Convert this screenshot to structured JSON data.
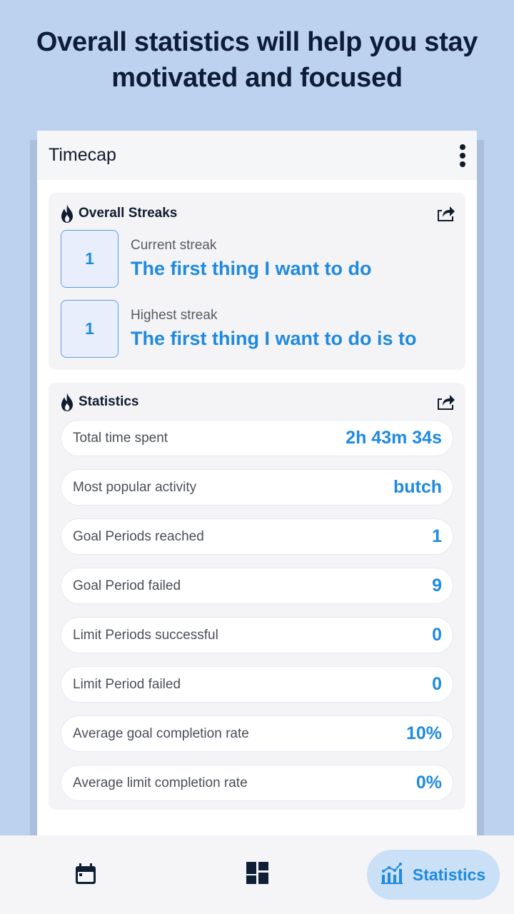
{
  "headline": {
    "line1": "Overall statistics will help you stay",
    "line2": "motivated and focused"
  },
  "appbar": {
    "title": "Timecap",
    "more_icon": "more-vertical-icon"
  },
  "streaks": {
    "title": "Overall Streaks",
    "title_icon": "flame-icon",
    "share_icon": "share-icon",
    "items": [
      {
        "count": "1",
        "label": "Current streak",
        "activity": "The first thing I want to do"
      },
      {
        "count": "1",
        "label": "Highest streak",
        "activity": "The first thing I want to do is to"
      }
    ]
  },
  "statistics": {
    "title": "Statistics",
    "title_icon": "flame-icon",
    "share_icon": "share-icon",
    "rows": [
      {
        "label": "Total time spent",
        "value": "2h 43m 34s"
      },
      {
        "label": "Most popular activity",
        "value": "butch"
      },
      {
        "label": "Goal Periods reached",
        "value": "1"
      },
      {
        "label": "Goal Period failed",
        "value": "9"
      },
      {
        "label": "Limit Periods successful",
        "value": "0"
      },
      {
        "label": "Limit Period failed",
        "value": "0"
      },
      {
        "label": "Average goal completion rate",
        "value": "10%"
      },
      {
        "label": "Average limit completion rate",
        "value": "0%"
      }
    ]
  },
  "bottom_nav": {
    "items": [
      {
        "icon": "calendar-icon",
        "label": ""
      },
      {
        "icon": "dashboard-icon",
        "label": ""
      },
      {
        "icon": "chart-icon",
        "label": "Statistics",
        "active": true
      }
    ]
  },
  "colors": {
    "background": "#bcd2ee",
    "accent": "#1f8ae0",
    "dark_text": "#0d1d38",
    "active_nav_bg": "#c9e0f6"
  }
}
